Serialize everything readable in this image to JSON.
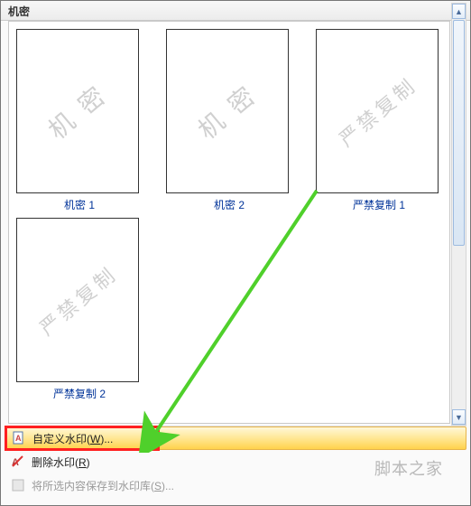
{
  "header": {
    "title": "机密"
  },
  "thumbs": [
    {
      "watermark": "机 密",
      "label": "机密 1"
    },
    {
      "watermark": "机 密",
      "label": "机密 2"
    },
    {
      "watermark": "严禁复制",
      "label": "严禁复制 1"
    },
    {
      "watermark": "严禁复制",
      "label": "严禁复制 2"
    }
  ],
  "menu": {
    "custom": {
      "prefix": "自定义水印(",
      "hotkey": "W",
      "suffix": ")..."
    },
    "remove": {
      "prefix": "删除水印(",
      "hotkey": "R",
      "suffix": ")"
    },
    "save": {
      "prefix": "将所选内容保存到水印库(",
      "hotkey": "S",
      "suffix": ")..."
    }
  },
  "credit": "脚本之家"
}
